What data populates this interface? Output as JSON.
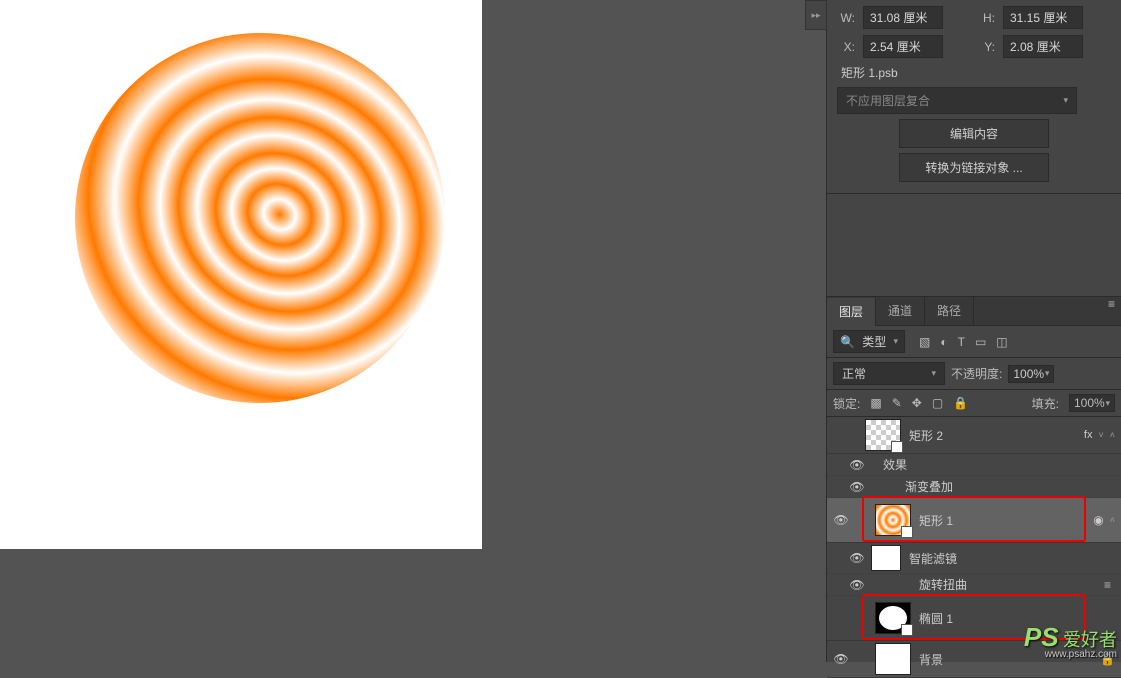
{
  "properties": {
    "w_label": "W:",
    "w_value": "31.08 厘米",
    "h_label": "H:",
    "h_value": "31.15 厘米",
    "x_label": "X:",
    "x_value": "2.54 厘米",
    "y_label": "Y:",
    "y_value": "2.08 厘米",
    "linked_file": "矩形 1.psb",
    "composite_label": "不应用图层复合",
    "edit_content_btn": "编辑内容",
    "convert_link_btn": "转换为链接对象 ..."
  },
  "panel_tabs": {
    "layers": "图层",
    "channels": "通道",
    "paths": "路径"
  },
  "layer_filter": {
    "kind": "类型"
  },
  "blend": {
    "mode": "正常",
    "opacity_label": "不透明度:",
    "opacity_value": "100%",
    "lock_label": "锁定:",
    "fill_label": "填充:",
    "fill_value": "100%"
  },
  "layers": {
    "rect2": "矩形 2",
    "effects": "效果",
    "grad_overlay": "渐变叠加",
    "rect1": "矩形 1",
    "smart_filters": "智能滤镜",
    "twirl": "旋转扭曲",
    "ellipse1": "椭圆 1",
    "background": "背景",
    "fx": "fx"
  },
  "watermark": {
    "main": "PS",
    "cn": "爱好者",
    "url": "www.psahz.com"
  },
  "icons": {
    "eye": "👁",
    "lock": "🔒",
    "search": "🔍",
    "collapse": "▸▸"
  }
}
